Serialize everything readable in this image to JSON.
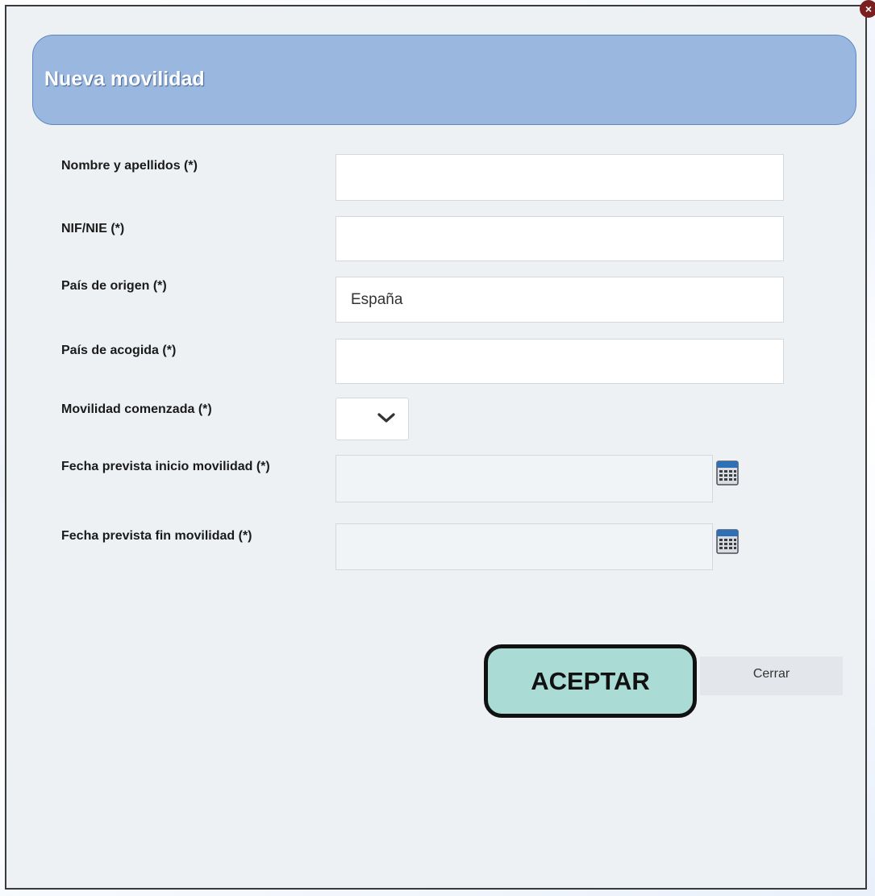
{
  "dialog": {
    "title": "Nueva movilidad",
    "close_glyph": "×"
  },
  "fields": {
    "nombre": {
      "label": "Nombre y apellidos (*)",
      "value": ""
    },
    "nif": {
      "label": "NIF/NIE (*)",
      "value": ""
    },
    "pais_origen": {
      "label": "País de origen (*)",
      "value": "España"
    },
    "pais_acogida": {
      "label": "País de acogida (*)",
      "value": ""
    },
    "movilidad_comenzada": {
      "label": "Movilidad comenzada (*)",
      "value": ""
    },
    "fecha_inicio": {
      "label": "Fecha prevista inicio movilidad (*)",
      "value": ""
    },
    "fecha_fin": {
      "label": "Fecha prevista fin movilidad (*)",
      "value": ""
    }
  },
  "buttons": {
    "accept": "ACEPTAR",
    "close": "Cerrar"
  },
  "icons": {
    "calendar": "calendar-icon",
    "dropdown": "chevron-down-icon",
    "close": "close-icon"
  },
  "colors": {
    "header_bg": "#9ab8df",
    "accept_bg": "#aadbd4",
    "modal_bg": "#eef1f4"
  }
}
